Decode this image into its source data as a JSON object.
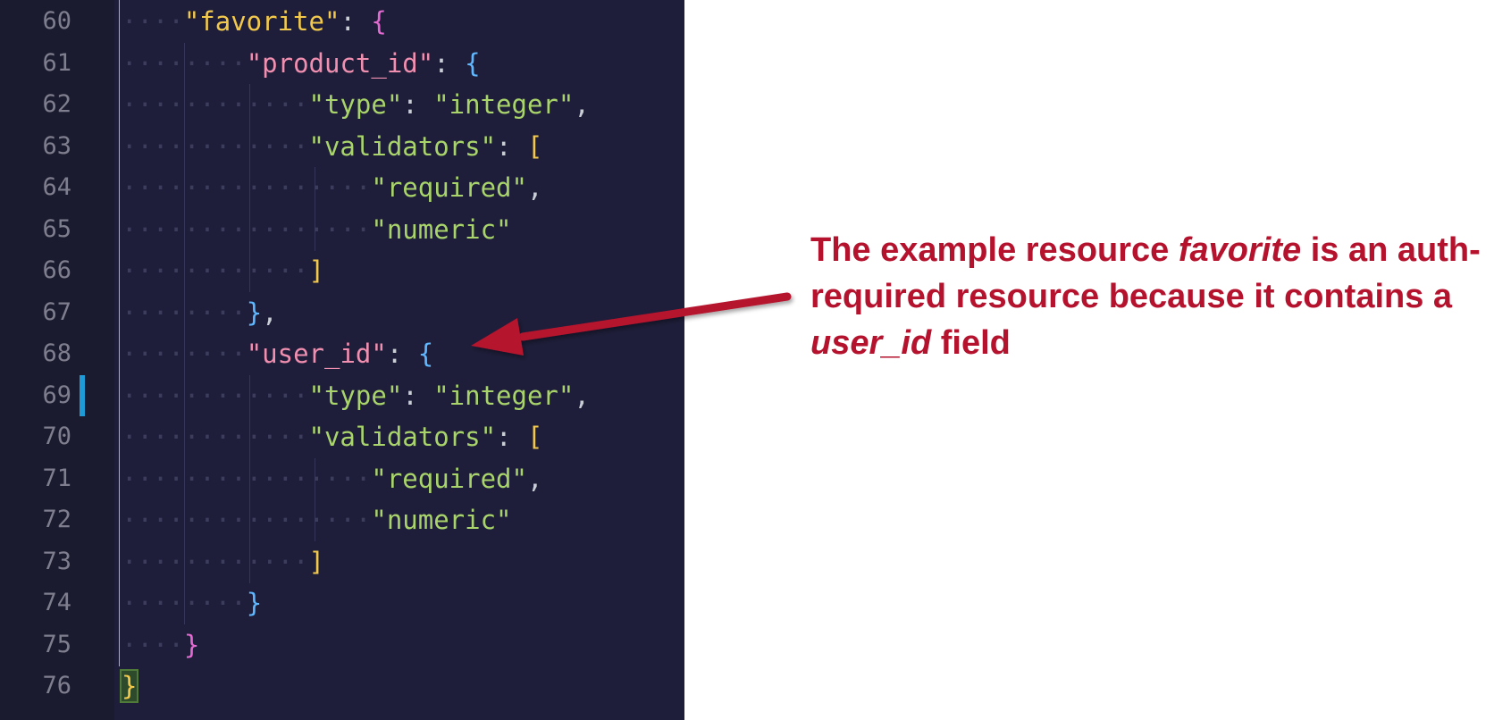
{
  "editor": {
    "lines": [
      {
        "number": "60",
        "indent": "....",
        "tokens": [
          {
            "t": "\"favorite\"",
            "c": "tok-key-y"
          },
          {
            "t": ": ",
            "c": "tok-punc"
          },
          {
            "t": "{",
            "c": "br-mag"
          }
        ]
      },
      {
        "number": "61",
        "indent": "........",
        "tokens": [
          {
            "t": "\"product_id\"",
            "c": "tok-key-p"
          },
          {
            "t": ": ",
            "c": "tok-punc"
          },
          {
            "t": "{",
            "c": "br-blue"
          }
        ]
      },
      {
        "number": "62",
        "indent": "............",
        "tokens": [
          {
            "t": "\"type\"",
            "c": "tok-key-g"
          },
          {
            "t": ": ",
            "c": "tok-punc"
          },
          {
            "t": "\"integer\"",
            "c": "tok-str"
          },
          {
            "t": ",",
            "c": "tok-punc"
          }
        ]
      },
      {
        "number": "63",
        "indent": "............",
        "tokens": [
          {
            "t": "\"validators\"",
            "c": "tok-key-g"
          },
          {
            "t": ": ",
            "c": "tok-punc"
          },
          {
            "t": "[",
            "c": "br-yel"
          }
        ]
      },
      {
        "number": "64",
        "indent": "................",
        "tokens": [
          {
            "t": "\"required\"",
            "c": "tok-str"
          },
          {
            "t": ",",
            "c": "tok-punc"
          }
        ]
      },
      {
        "number": "65",
        "indent": "................",
        "tokens": [
          {
            "t": "\"numeric\"",
            "c": "tok-str"
          }
        ]
      },
      {
        "number": "66",
        "indent": "............",
        "tokens": [
          {
            "t": "]",
            "c": "br-yel"
          }
        ]
      },
      {
        "number": "67",
        "indent": "........",
        "tokens": [
          {
            "t": "}",
            "c": "br-blue"
          },
          {
            "t": ",",
            "c": "tok-punc"
          }
        ]
      },
      {
        "number": "68",
        "indent": "........",
        "tokens": [
          {
            "t": "\"user_id\"",
            "c": "tok-key-p"
          },
          {
            "t": ": ",
            "c": "tok-punc"
          },
          {
            "t": "{",
            "c": "br-blue"
          }
        ]
      },
      {
        "number": "69",
        "indent": "............",
        "modified": true,
        "tokens": [
          {
            "t": "\"type\"",
            "c": "tok-key-g"
          },
          {
            "t": ": ",
            "c": "tok-punc"
          },
          {
            "t": "\"integer\"",
            "c": "tok-str"
          },
          {
            "t": ",",
            "c": "tok-punc"
          }
        ]
      },
      {
        "number": "70",
        "indent": "............",
        "tokens": [
          {
            "t": "\"validators\"",
            "c": "tok-key-g"
          },
          {
            "t": ": ",
            "c": "tok-punc"
          },
          {
            "t": "[",
            "c": "br-yel"
          }
        ]
      },
      {
        "number": "71",
        "indent": "................",
        "tokens": [
          {
            "t": "\"required\"",
            "c": "tok-str"
          },
          {
            "t": ",",
            "c": "tok-punc"
          }
        ]
      },
      {
        "number": "72",
        "indent": "................",
        "tokens": [
          {
            "t": "\"numeric\"",
            "c": "tok-str"
          }
        ]
      },
      {
        "number": "73",
        "indent": "............",
        "tokens": [
          {
            "t": "]",
            "c": "br-yel"
          }
        ]
      },
      {
        "number": "74",
        "indent": "........",
        "tokens": [
          {
            "t": "}",
            "c": "br-blue"
          }
        ]
      },
      {
        "number": "75",
        "indent": "....",
        "tokens": [
          {
            "t": "}",
            "c": "br-mag"
          }
        ]
      },
      {
        "number": "76",
        "indent": "",
        "tokens": [
          {
            "t": "}",
            "c": "br-yel bracket-match"
          }
        ]
      }
    ],
    "colors": {
      "background": "#1e1e3a",
      "gutter": "#1b1b30",
      "line_number": "#7e7e8e",
      "modified_marker": "#1e9bd7"
    }
  },
  "annotation": {
    "part1": "The example resource ",
    "em1": "favorite",
    "part2": " is an auth-required resource because it contains a ",
    "em2": "user_id",
    "part3": " field",
    "color": "#b5122e"
  },
  "icons": {
    "arrow": "arrow-pointing-left-icon"
  }
}
